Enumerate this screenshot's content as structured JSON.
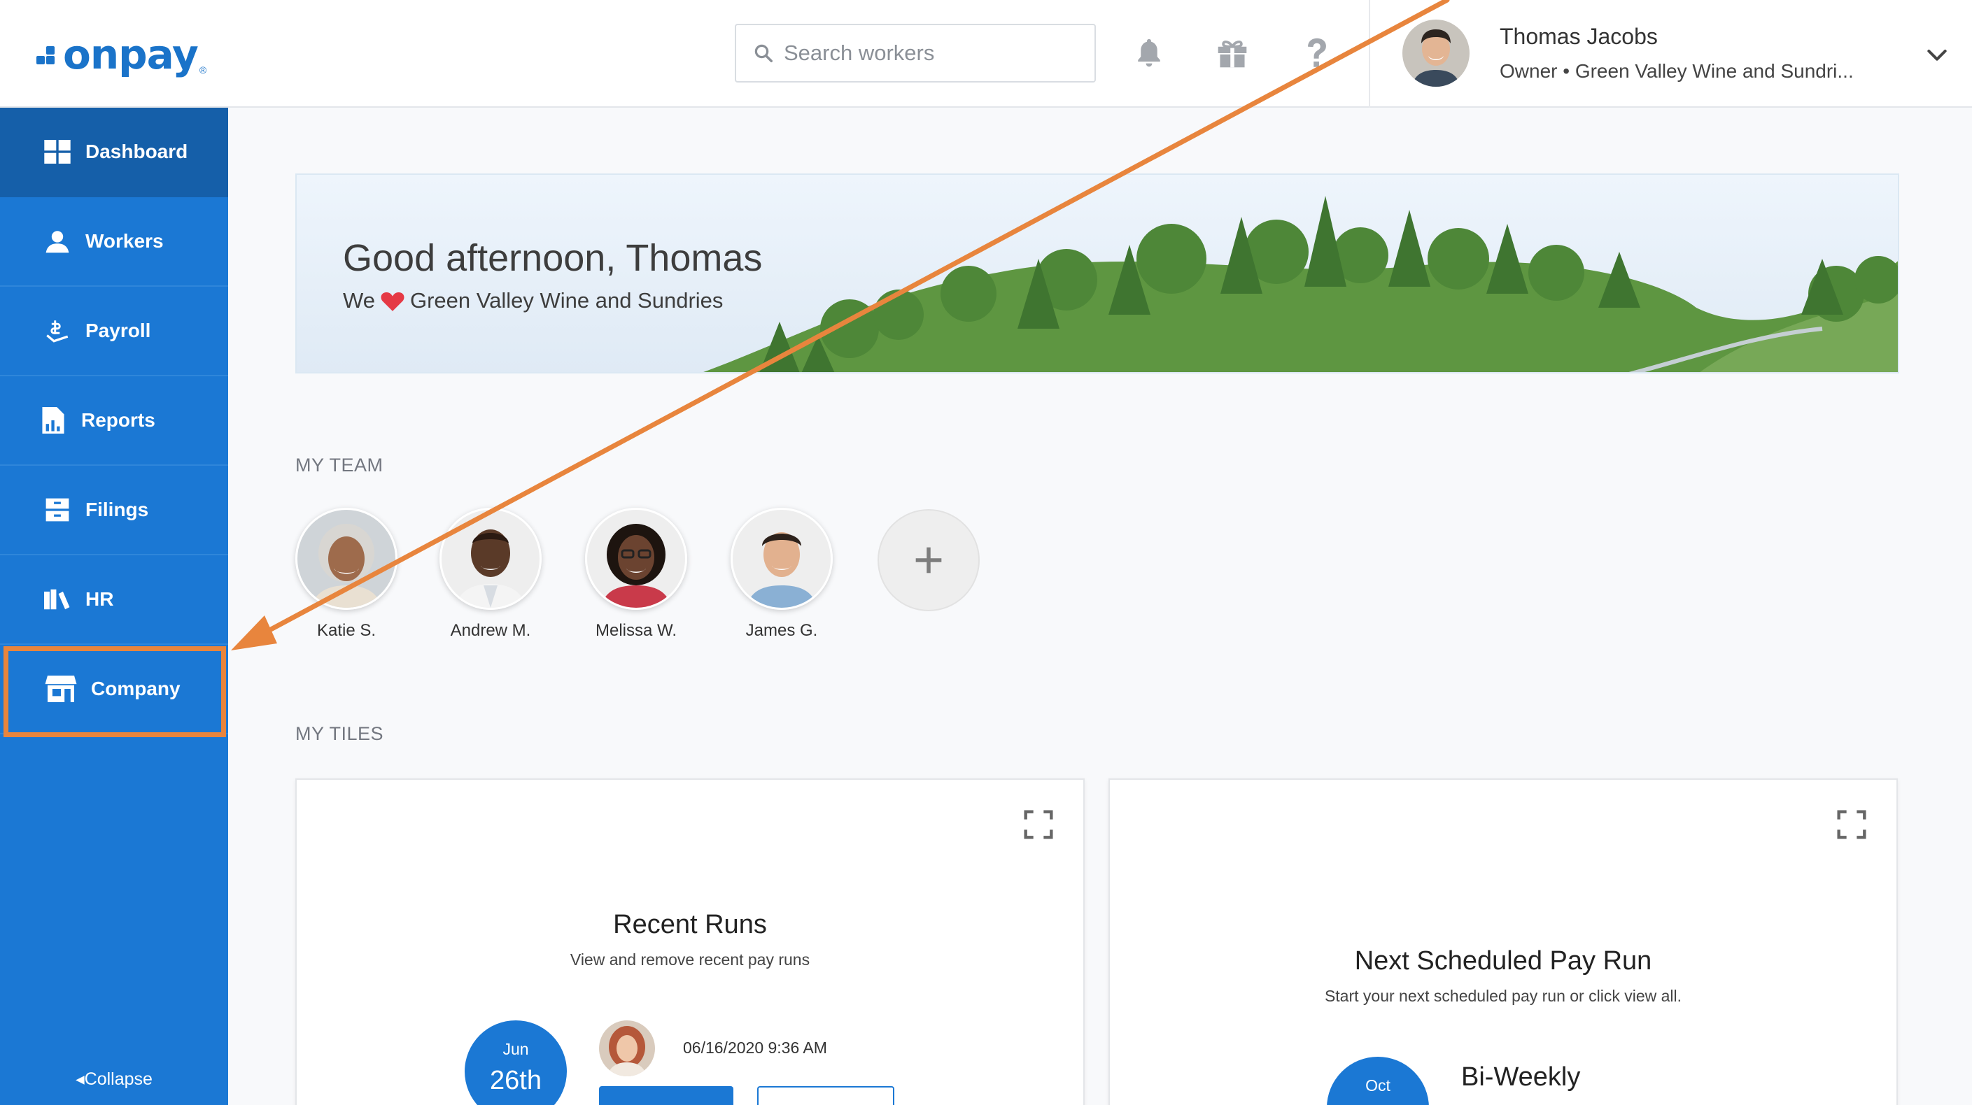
{
  "header": {
    "logo_text": "onpay",
    "logo_mark": "®",
    "search_placeholder": "Search workers",
    "user_name": "Thomas Jacobs",
    "user_role": "Owner • Green Valley Wine and Sundri..."
  },
  "sidebar": {
    "items": [
      {
        "label": "Dashboard",
        "icon": "dashboard-icon",
        "active": true
      },
      {
        "label": "Workers",
        "icon": "workers-icon"
      },
      {
        "label": "Payroll",
        "icon": "payroll-icon"
      },
      {
        "label": "Reports",
        "icon": "reports-icon"
      },
      {
        "label": "Filings",
        "icon": "filings-icon"
      },
      {
        "label": "HR",
        "icon": "hr-icon"
      },
      {
        "label": "Company",
        "icon": "company-icon",
        "highlighted": true
      }
    ],
    "collapse_label": "Collapse"
  },
  "banner": {
    "greeting": "Good afternoon, Thomas",
    "sub_prefix": "We",
    "company": "Green Valley Wine and Sundries"
  },
  "team": {
    "label": "MY TEAM",
    "members": [
      "Katie S.",
      "Andrew M.",
      "Melissa W.",
      "James G."
    ]
  },
  "tiles": {
    "label": "MY TILES",
    "recent_runs": {
      "title": "Recent Runs",
      "subtitle": "View and remove recent pay runs",
      "month": "Jun",
      "day": "26th",
      "timestamp": "06/16/2020 9:36 AM"
    },
    "next_run": {
      "title": "Next Scheduled Pay Run",
      "subtitle": "Start your next scheduled pay run or click view all.",
      "month": "Oct",
      "frequency": "Bi-Weekly"
    }
  },
  "colors": {
    "brand": "#1b78d4",
    "sidebar_active": "#155fa9",
    "annotation": "#e8853d",
    "heart": "#e53945"
  }
}
